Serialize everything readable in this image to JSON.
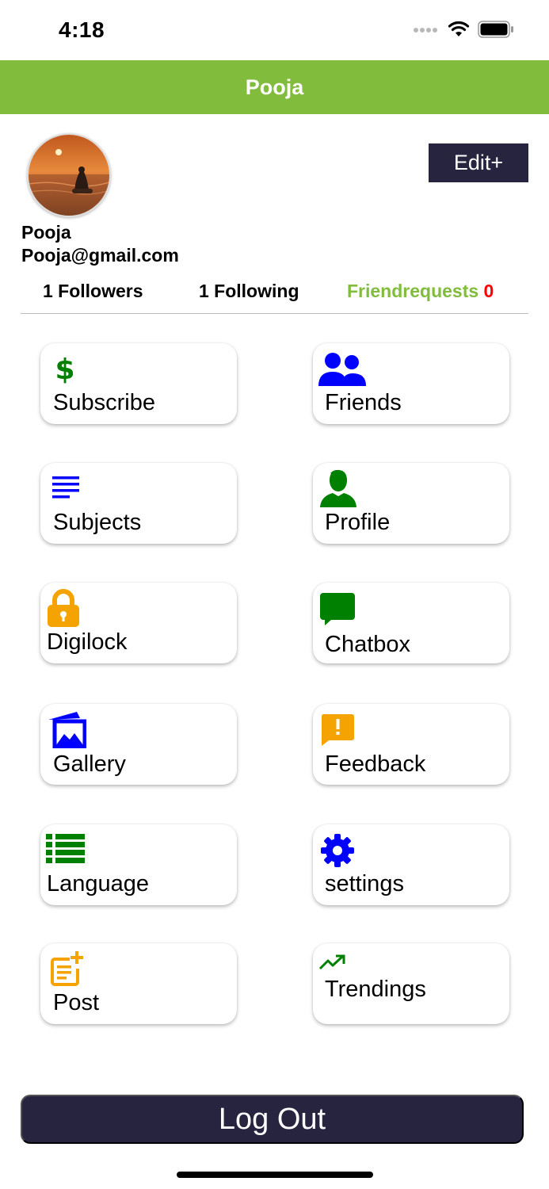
{
  "status_bar": {
    "time": "4:18"
  },
  "nav": {
    "title": "Pooja"
  },
  "profile": {
    "name": "Pooja",
    "email": "Pooja@gmail.com",
    "edit_label": "Edit+"
  },
  "stats": {
    "followers": "1 Followers",
    "following": "1 Following",
    "friendrequests_label": "Friendrequests",
    "friendrequests_count": "0"
  },
  "menu": {
    "items": [
      {
        "label": "Subscribe",
        "icon": "dollar-icon",
        "icon_color": "#008000"
      },
      {
        "label": "Friends",
        "icon": "people-icon",
        "icon_color": "#0000ff"
      },
      {
        "label": "Subjects",
        "icon": "lines-icon",
        "icon_color": "#0000ff"
      },
      {
        "label": "Profile",
        "icon": "person-icon",
        "icon_color": "#008000"
      },
      {
        "label": "Digilock",
        "icon": "lock-icon",
        "icon_color": "#f5a300"
      },
      {
        "label": "Chatbox",
        "icon": "chat-icon",
        "icon_color": "#008000"
      },
      {
        "label": "Gallery",
        "icon": "gallery-icon",
        "icon_color": "#0000ff"
      },
      {
        "label": "Feedback",
        "icon": "feedback-icon",
        "icon_color": "#f5a300"
      },
      {
        "label": "Language",
        "icon": "list-icon",
        "icon_color": "#008000"
      },
      {
        "label": "settings",
        "icon": "gear-icon",
        "icon_color": "#0000ff"
      },
      {
        "label": "Post",
        "icon": "post-add-icon",
        "icon_color": "#f5a300"
      },
      {
        "label": "Trendings",
        "icon": "trending-up-icon",
        "icon_color": "#008000"
      }
    ]
  },
  "logout": {
    "label": "Log Out"
  },
  "colors": {
    "accent": "#82bc3d",
    "dark_button": "#272440",
    "alert": "#ff0000"
  }
}
